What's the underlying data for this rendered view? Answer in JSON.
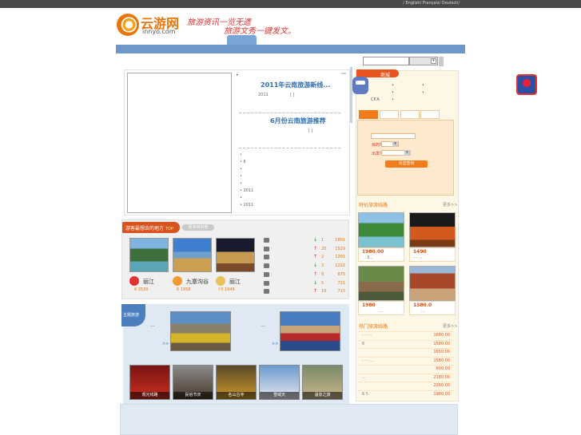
{
  "header": {
    "languages": "/ English/ Français/ Deutsch/",
    "logo_cn": "云游网",
    "logo_en": "innyo.com",
    "slogan_line1": "旅游资讯一览无遗",
    "slogan_line2": "旅游文秀一键发文。"
  },
  "search": {
    "placeholder": "",
    "select_value": ""
  },
  "news": {
    "marker": "•",
    "headline1": "2011年云南旅游新线...",
    "sub1_date": "2011",
    "sub1_bracket": "[ ]",
    "headline2": "6月份云南旅游推荐",
    "sub2_bracket": "[ ]",
    "bullets": [
      "•",
      "• 6",
      "•",
      "•",
      "•",
      "• 2011",
      "•",
      "• 2011"
    ]
  },
  "popular": {
    "tab_label": "游客最想去的地方",
    "tab_badge": "TOP",
    "tab2_label": "更多目的地",
    "places": [
      {
        "name": "丽江",
        "meta": "6  3530"
      },
      {
        "name": "九寨沟谷",
        "meta": "6  1958"
      },
      {
        "name": "丽江",
        "meta": "↑5  1949"
      }
    ],
    "ranks": [
      {
        "arrow": "↓",
        "n": "1",
        "v": "1801"
      },
      {
        "arrow": "↑",
        "n": "20",
        "v": "1529"
      },
      {
        "arrow": "↑",
        "n": "2",
        "v": "1201"
      },
      {
        "arrow": "↓",
        "n": "3",
        "v": "1222"
      },
      {
        "arrow": "↑",
        "n": "9",
        "v": "875"
      },
      {
        "arrow": "↓",
        "n": "5",
        "v": "721"
      },
      {
        "arrow": "↑",
        "n": "10",
        "v": "715"
      }
    ]
  },
  "lower": {
    "tag": "主题旅游",
    "big_left_caption": "...",
    "big_left_link": ">>",
    "big_right_caption": "...",
    "big_right_link": ">>",
    "thumbs": [
      "观光线路",
      "民俗节庆",
      "名山古寺",
      "雪域天",
      "温泉之旅"
    ]
  },
  "right": {
    "mall_label": "商城",
    "robot_text": "CP.A",
    "field_labels": [
      "目的地",
      "出发地"
    ],
    "query_button": "点击查询",
    "section1_title": "特价旅游线路",
    "section1_more": "更多>>",
    "tours": [
      {
        "price": "1980.00",
        "desc": "3..."
      },
      {
        "price": "1490",
        "desc": "- - ..."
      },
      {
        "price": "1980",
        "desc": "..."
      },
      {
        "price": "1380.0",
        "desc": "..."
      }
    ],
    "section2_title": "热门旅游线路",
    "section2_more": "更多>>",
    "price_list": [
      {
        "t": "- - - -",
        "p": "1680.00"
      },
      {
        "t": "6",
        "p": "1580.00"
      },
      {
        "t": "",
        "p": "1650.00"
      },
      {
        "t": "- -   -   ...",
        "p": "1580.00"
      },
      {
        "t": "",
        "p": "800.00"
      },
      {
        "t": "...",
        "p": "2180.00"
      },
      {
        "t": "",
        "p": "2280.00"
      },
      {
        "t": "6 5",
        "p": "1980.00"
      }
    ]
  }
}
